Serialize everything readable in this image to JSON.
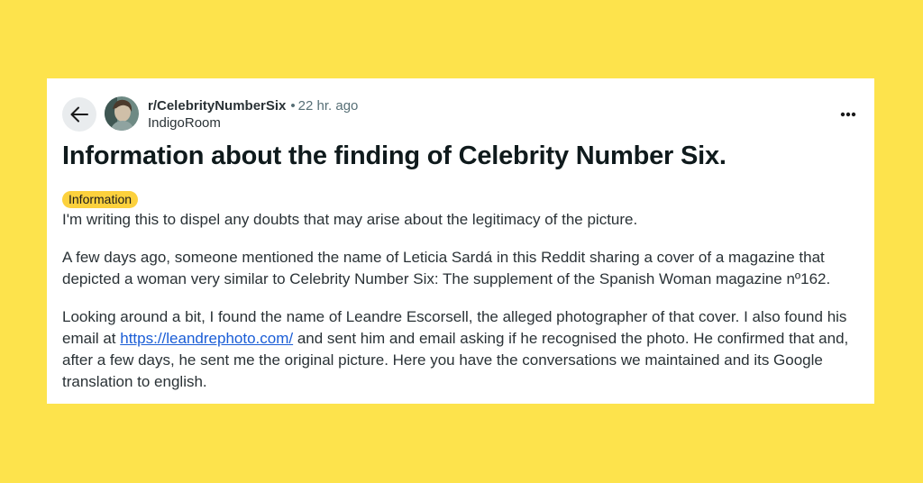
{
  "post": {
    "subreddit": "r/CelebrityNumberSix",
    "separator": "•",
    "time": "22 hr. ago",
    "author": "IndigoRoom",
    "title": "Information about the finding of Celebrity Number Six.",
    "flair": "Information",
    "paragraph1": "I'm writing this to dispel any doubts that may arise about the legitimacy of the picture.",
    "paragraph2": "A few days ago, someone mentioned the name of Leticia Sardá in this Reddit sharing a cover of a magazine that depicted a woman very similar to Celebrity Number Six: The supplement of the Spanish Woman magazine nº162.",
    "paragraph3_before": "Looking around a bit, I found the name of Leandre Escorsell, the alleged photographer of that cover. I also found his email at ",
    "paragraph3_link": "https://leandrephoto.com/",
    "paragraph3_after": " and sent him and email asking if he recognised the photo. He confirmed that and, after a few days, he sent me the original picture. Here you have the conversations we maintained and its Google translation to english."
  },
  "icons": {
    "back": "arrow-left-icon",
    "more": "more-horizontal-icon"
  },
  "colors": {
    "background": "#fde34c",
    "flair": "#fcd13d",
    "link": "#1a5dd6"
  }
}
